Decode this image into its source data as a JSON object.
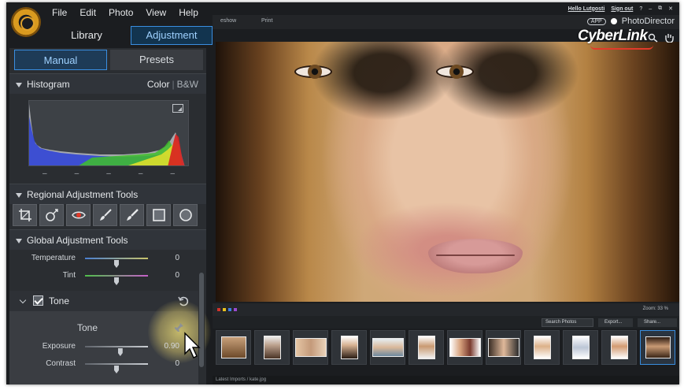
{
  "menu": [
    "File",
    "Edit",
    "Photo",
    "View",
    "Help"
  ],
  "modules": {
    "library": "Library",
    "adjustment": "Adjustment"
  },
  "topright": {
    "hello": "Hello Lutgosti",
    "signout": "Sign out",
    "help": "?",
    "app_badge": "APP",
    "product": "PhotoDirector"
  },
  "modebar": {
    "slideshow": "eshow",
    "print": "Print"
  },
  "brand": "CyberLink",
  "subtabs": {
    "manual": "Manual",
    "presets": "Presets"
  },
  "histogram": {
    "title": "Histogram",
    "color": "Color",
    "bw": "B&W",
    "ticks": [
      "–",
      "–",
      "–",
      "–",
      "–"
    ]
  },
  "regional": {
    "title": "Regional Adjustment Tools"
  },
  "global": {
    "title": "Global Adjustment Tools"
  },
  "sliders_top": [
    {
      "label": "Temperature",
      "value": "0",
      "position": 0.5
    },
    {
      "label": "Tint",
      "value": "0",
      "position": 0.5
    }
  ],
  "tone": {
    "title": "Tone",
    "subtitle": "Tone",
    "sliders": [
      {
        "label": "Exposure",
        "value": "0.90",
        "position": 0.56
      },
      {
        "label": "Contrast",
        "value": "0",
        "position": 0.5
      }
    ]
  },
  "filmbar": {
    "zoom": "Zoom: 33 %",
    "search_placeholder": "Search Photos",
    "export": "Export...",
    "share": "Share..."
  },
  "filmstrip_count": 12,
  "path": "Latest Imports / kate.jpg",
  "colors": {
    "accent": "#3a8ee0",
    "panel": "#2a2d31",
    "brand_red": "#e23a2a"
  }
}
